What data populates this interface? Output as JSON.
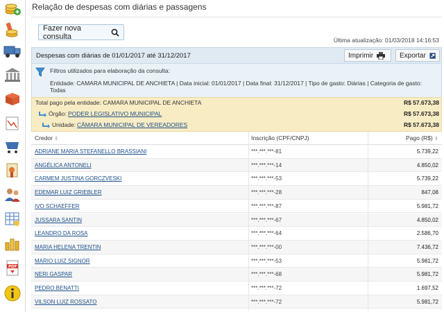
{
  "page": {
    "title": "Relação de despesas com diárias e passagens",
    "new_query_label": "Fazer nova consulta",
    "last_update": "Última atualização: 01/03/2018 14:16:53"
  },
  "panel": {
    "header_title": "Despesas com diárias de 01/01/2017 até 31/12/2017",
    "print_label": "Imprimir",
    "export_label": "Exportar"
  },
  "filters": {
    "title": "Filtros utilizados para elaboração da consulta:",
    "text": "Entidade: CAMARA MUNICIPAL DE ANCHIETA | Data inicial: 01/01/2017 | Data final: 31/12/2017 | Tipo de gasto: Diárias | Categoria de gasto: Todas"
  },
  "totals": {
    "entity_label": "Total pago pela entidade: CAMARA MUNICIPAL DE ANCHIETA",
    "entity_value": "R$ 57.673,38",
    "organ_prefix": "Órgão:",
    "organ_name": "PODER LEGISLATIVO MUNICIPAL",
    "organ_value": "R$ 57.673,38",
    "unit_prefix": "Unidade:",
    "unit_name": "CÂMARA MUNICIPAL DE VEREADORES",
    "unit_value": "R$ 57.673,38"
  },
  "table": {
    "col_creditor": "Credor",
    "col_doc": "Inscrição (CPF/CNPJ)",
    "col_paid": "Pago (R$)",
    "sort_glyph": "⇕",
    "rows": [
      {
        "name": "ADRIANE MARIA STEFANELLO BRASSIANI",
        "doc": "***.***.***-81",
        "paid": "5.739,22"
      },
      {
        "name": "ANGÉLICA ANTONELI",
        "doc": "***.***.***-14",
        "paid": "4.850,02"
      },
      {
        "name": "CARMEM JUSTINA GORCZVESKI",
        "doc": "***.***.***-53",
        "paid": "5.739,22"
      },
      {
        "name": "EDEMAR LUIZ GRIEBLER",
        "doc": "***.***.***-28",
        "paid": "847,08"
      },
      {
        "name": "IVO SCHAEFFER",
        "doc": "***.***.***-87",
        "paid": "5.981,72"
      },
      {
        "name": "JUSSARA SANTIN",
        "doc": "***.***.***-67",
        "paid": "4.850,02"
      },
      {
        "name": "LEANDRO DA ROSA",
        "doc": "***.***.***-64",
        "paid": "2.586,70"
      },
      {
        "name": "MARIA HELENA TRENTIN",
        "doc": "***.***.***-00",
        "paid": "7.436,72"
      },
      {
        "name": "MARIO LUIZ SIGNOR",
        "doc": "***.***.***-53",
        "paid": "5.981,72"
      },
      {
        "name": "NERI GASPAR",
        "doc": "***.***.***-68",
        "paid": "5.981,72"
      },
      {
        "name": "PEDRO BENATTI",
        "doc": "***.***.***-72",
        "paid": "1.697,52"
      },
      {
        "name": "VILSON LUIZ ROSSATO",
        "doc": "***.***.***-72",
        "paid": "5.981,72"
      }
    ]
  },
  "sidebar": {
    "icons": [
      "coins-add-icon",
      "coins-pencil-icon",
      "truck-icon",
      "bank-icon",
      "box-icon",
      "calculator-icon",
      "shopping-cart-icon",
      "certificate-icon",
      "people-icon",
      "spreadsheet-icon",
      "coin-stack-icon",
      "pdf-icon",
      "info-icon"
    ]
  },
  "colors": {
    "header_bg": "#dfeaf3",
    "filter_bg": "#eaf2f8",
    "total_bg": "#f8ecc4",
    "link": "#1b4f8a"
  }
}
